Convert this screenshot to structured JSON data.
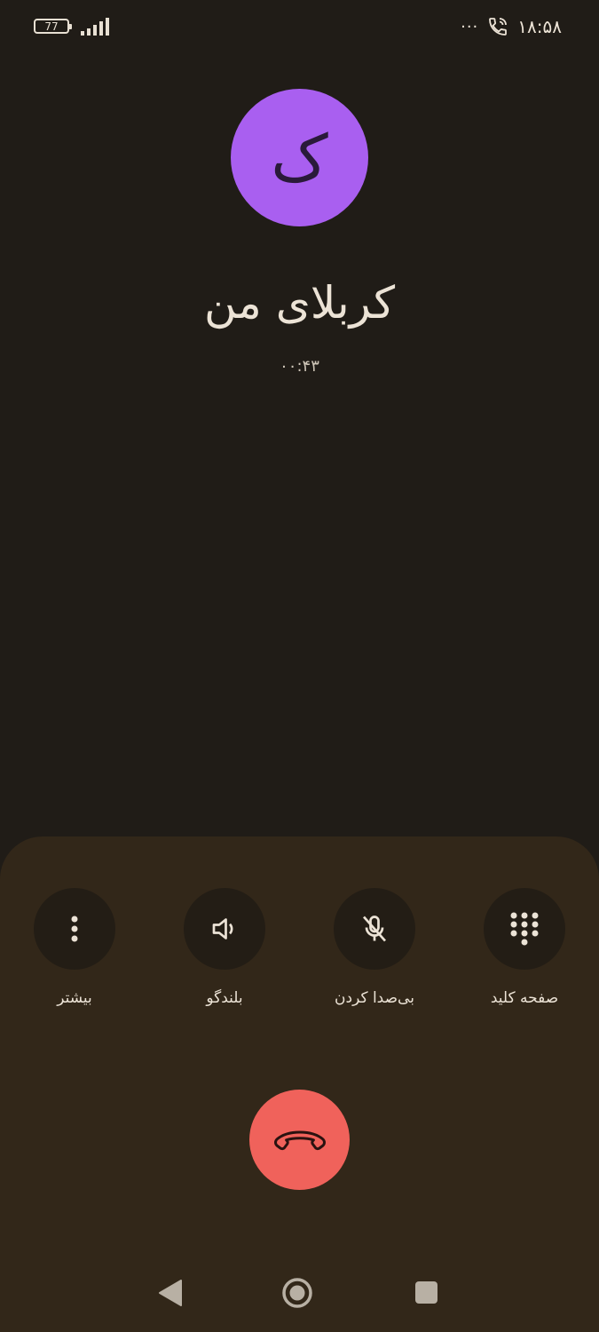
{
  "status_bar": {
    "battery_level": "77",
    "time": "۱۸:۵۸",
    "more_dots": "···"
  },
  "caller": {
    "avatar_initial": "ک",
    "name": "کربلای من",
    "duration": "۰۰:۴۳"
  },
  "controls": [
    {
      "id": "keypad",
      "label": "صفحه کلید",
      "icon": "dialpad-icon"
    },
    {
      "id": "mute",
      "label": "بی‌صدا کردن",
      "icon": "mic-off-icon"
    },
    {
      "id": "speaker",
      "label": "بلندگو",
      "icon": "speaker-icon"
    },
    {
      "id": "more",
      "label": "بیشتر",
      "icon": "more-vertical-icon"
    }
  ],
  "colors": {
    "background": "#201c17",
    "panel": "#322719",
    "avatar": "#a95ff0",
    "end_call": "#f0625b"
  }
}
